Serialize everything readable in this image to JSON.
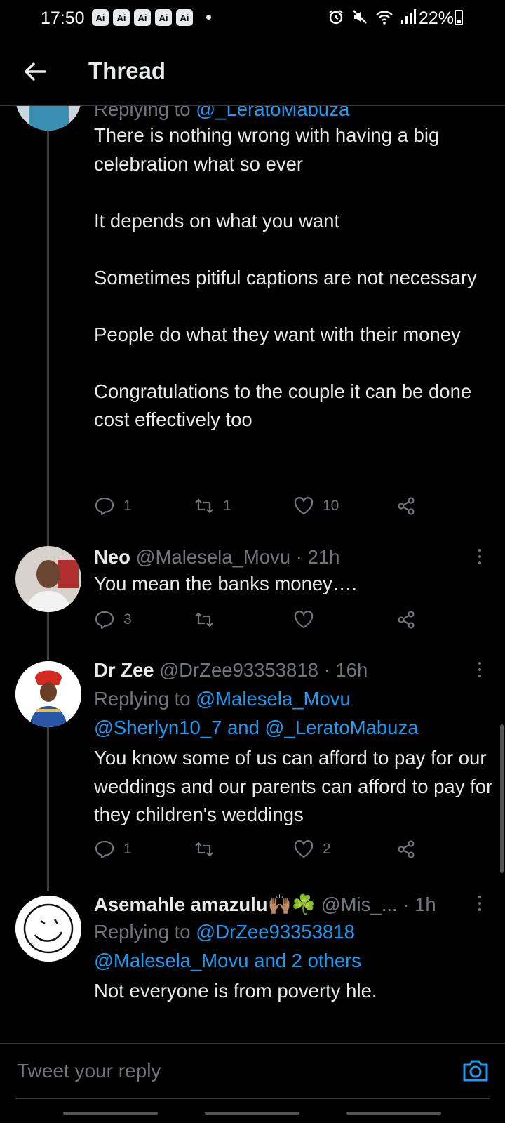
{
  "status_bar": {
    "time": "17:50",
    "notification_badges": [
      "Ai",
      "Ai",
      "Ai",
      "Ai",
      "Ai"
    ],
    "battery": "22%",
    "icons": [
      "alarm-icon",
      "mute-icon",
      "wifi-icon",
      "signal-icon",
      "battery-icon"
    ]
  },
  "header": {
    "title": "Thread",
    "back_icon": "arrow-left-icon"
  },
  "tweets": [
    {
      "replying_prefix": "Replying to",
      "replying_to": "@_LeratoMabuza",
      "text": "There is nothing wrong with having a big celebration what so ever\n\nIt depends on what you want\n\nSometimes pitiful captions are not necessary\n\nPeople do what they want with their money\n\nCongratulations to the couple it can be done cost effectively too",
      "replies": "1",
      "retweets": "1",
      "likes": "10"
    },
    {
      "name": "Neo",
      "handle": "@Malesela_Movu",
      "time": "· 21h",
      "text": "You mean the banks money….",
      "replies": "3",
      "retweets": "",
      "likes": ""
    },
    {
      "name": "Dr Zee",
      "handle": "@DrZee93353818",
      "time": "· 16h",
      "replying_prefix": "Replying to",
      "replying_to_1": "@Malesela_Movu",
      "replying_to_2": "@Sherlyn10_7 and @_LeratoMabuza",
      "text": "You know some of us can afford to pay for our weddings and our parents can afford to pay for they children's weddings",
      "replies": "1",
      "retweets": "",
      "likes": "2"
    },
    {
      "name": "Asemahle amazulu🙌🏽☘️",
      "handle": "@Mis_...",
      "time": "· 1h",
      "replying_prefix": "Replying to",
      "replying_to_1": "@DrZee93353818",
      "replying_to_2": "@Malesela_Movu and 2 others",
      "text": "Not everyone is from poverty hle."
    }
  ],
  "compose": {
    "placeholder": "Tweet your reply",
    "camera_icon": "camera-icon"
  },
  "colors": {
    "background": "#000000",
    "text": "#e7e9ea",
    "muted": "#71767b",
    "accent": "#1d9bf0"
  }
}
